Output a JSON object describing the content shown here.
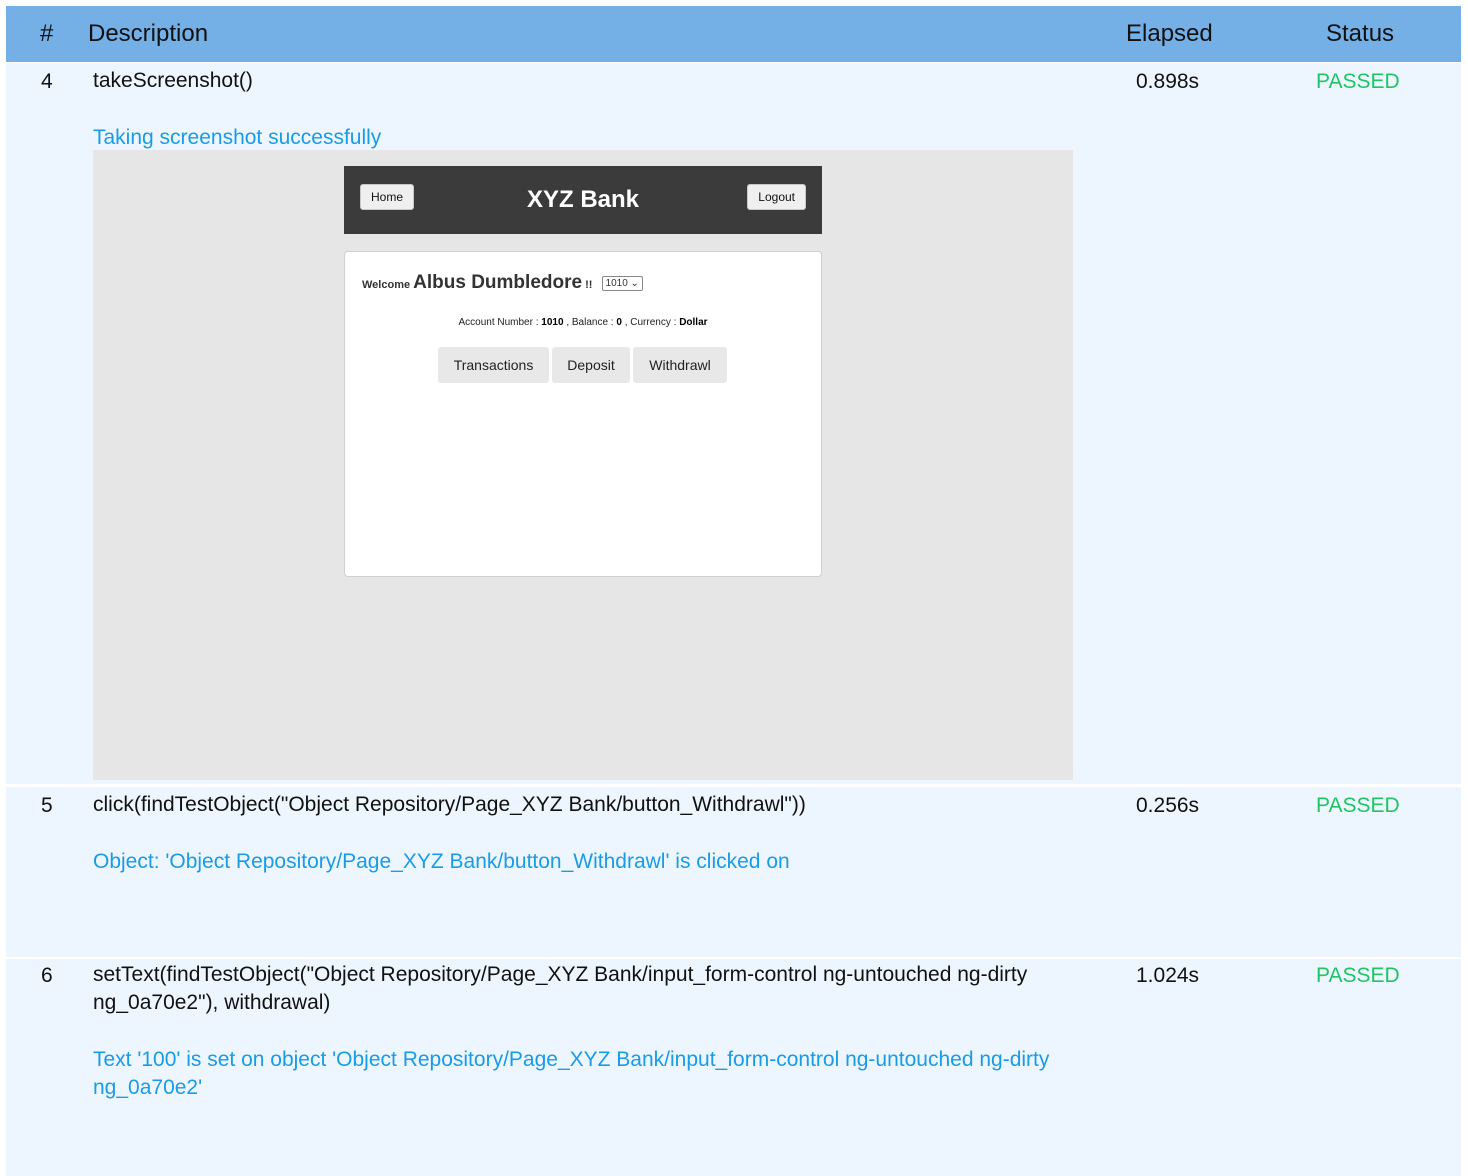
{
  "header": {
    "num": "#",
    "description": "Description",
    "elapsed": "Elapsed",
    "status": "Status"
  },
  "rows": [
    {
      "num": "4",
      "description": "takeScreenshot()",
      "elapsed": "0.898s",
      "status": "PASSED",
      "message": "Taking screenshot successfully"
    },
    {
      "num": "5",
      "description": "click(findTestObject(\"Object Repository/Page_XYZ Bank/button_Withdrawl\"))",
      "elapsed": "0.256s",
      "status": "PASSED",
      "message": "Object: 'Object Repository/Page_XYZ Bank/button_Withdrawl' is clicked on"
    },
    {
      "num": "6",
      "description": "setText(findTestObject(\"Object Repository/Page_XYZ Bank/input_form-control ng-untouched ng-dirty ng_0a70e2\"), withdrawal)",
      "elapsed": "1.024s",
      "status": "PASSED",
      "message": "Text '100' is set on object 'Object Repository/Page_XYZ Bank/input_form-control ng-untouched ng-dirty ng_0a70e2'"
    }
  ],
  "screenshot": {
    "home_label": "Home",
    "title": "XYZ Bank",
    "logout_label": "Logout",
    "welcome_label": "Welcome",
    "customer_name": "Albus Dumbledore",
    "exclaim": "!!",
    "account_select": "1010",
    "account_number_label": "Account Number :",
    "account_number": "1010",
    "balance_label": ", Balance :",
    "balance": "0",
    "currency_label": ", Currency :",
    "currency": "Dollar",
    "buttons": [
      "Transactions",
      "Deposit",
      "Withdrawl"
    ]
  },
  "colors": {
    "header_bg": "#74afe6",
    "row_bg": "#edf6fe",
    "passed": "#1fc463",
    "message": "#1a9be6"
  }
}
